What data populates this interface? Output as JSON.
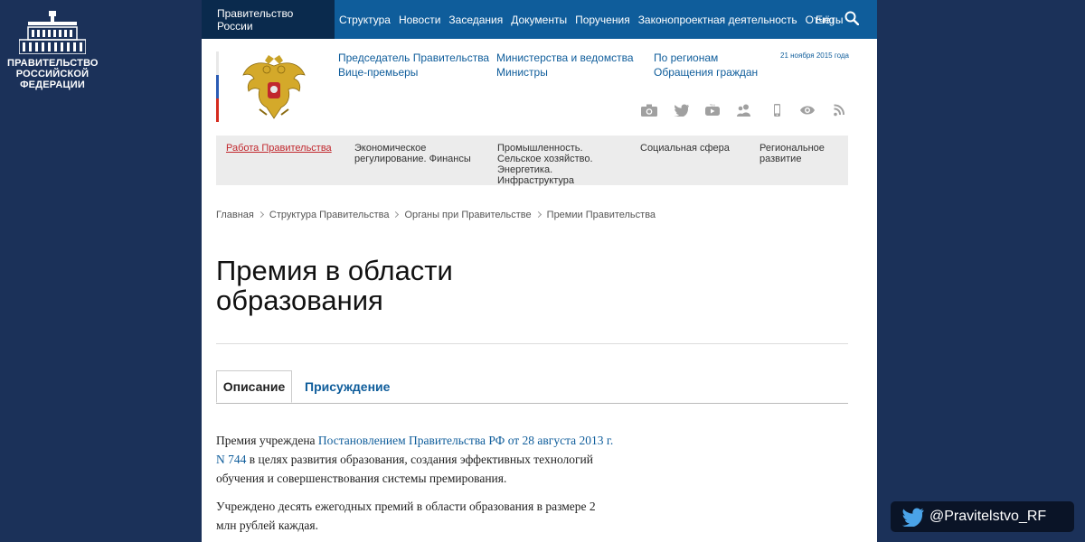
{
  "logo": {
    "lines": [
      "ПРАВИТЕЛЬСТВО",
      "РОССИЙСКОЙ",
      "ФЕДЕРАЦИИ"
    ]
  },
  "topnav": {
    "active": "Правительство России",
    "items": [
      "Структура",
      "Новости",
      "Заседания",
      "Документы",
      "Поручения",
      "Законопроектная деятельность",
      "Отчёты"
    ],
    "lang": "Eng",
    "search_icon": "search-icon"
  },
  "header": {
    "links_col1": [
      "Председатель Правительства",
      "Вице-премьеры"
    ],
    "links_col2": [
      "Министерства и ведомства",
      "Министры"
    ],
    "links_col3": [
      "По регионам",
      "Обращения граждан"
    ],
    "date": "21 ноября 2015 года",
    "social_icons": [
      "camera-icon",
      "twitter-icon",
      "youtube-icon",
      "people-icon",
      "mobile-icon",
      "eye-icon",
      "rss-icon"
    ],
    "flag_colors": [
      "#ffffff",
      "#2a5bb4",
      "#d52b1e"
    ]
  },
  "menu": {
    "items": [
      "Работа Правительства",
      "Экономическое регулирование. Финансы",
      "Промышленность. Сельское хозяйство. Энергетика. Инфраструктура",
      "Социальная сфера",
      "Региональное развитие"
    ]
  },
  "breadcrumb": [
    "Главная",
    "Структура Правительства",
    "Органы при Правительстве",
    "Премии Правительства"
  ],
  "title": "Премия в области образования",
  "tabs": [
    "Описание",
    "Присуждение"
  ],
  "content": {
    "p1_before": "Премия учреждена ",
    "p1_link": "Постановлением Правительства РФ от 28 августа 2013 г. N 744",
    "p1_after": " в целях развития образования, создания эффективных технологий обучения и совершенствования системы премирования.",
    "p2": "Учреждено десять ежегодных премий в области образования в размере 2 млн рублей каждая."
  },
  "twitter": {
    "handle": "@Pravitelstvo_RF"
  },
  "colors": {
    "brand": "#0f5d9b",
    "background": "#1b3159",
    "accent_red": "#c1272d"
  }
}
